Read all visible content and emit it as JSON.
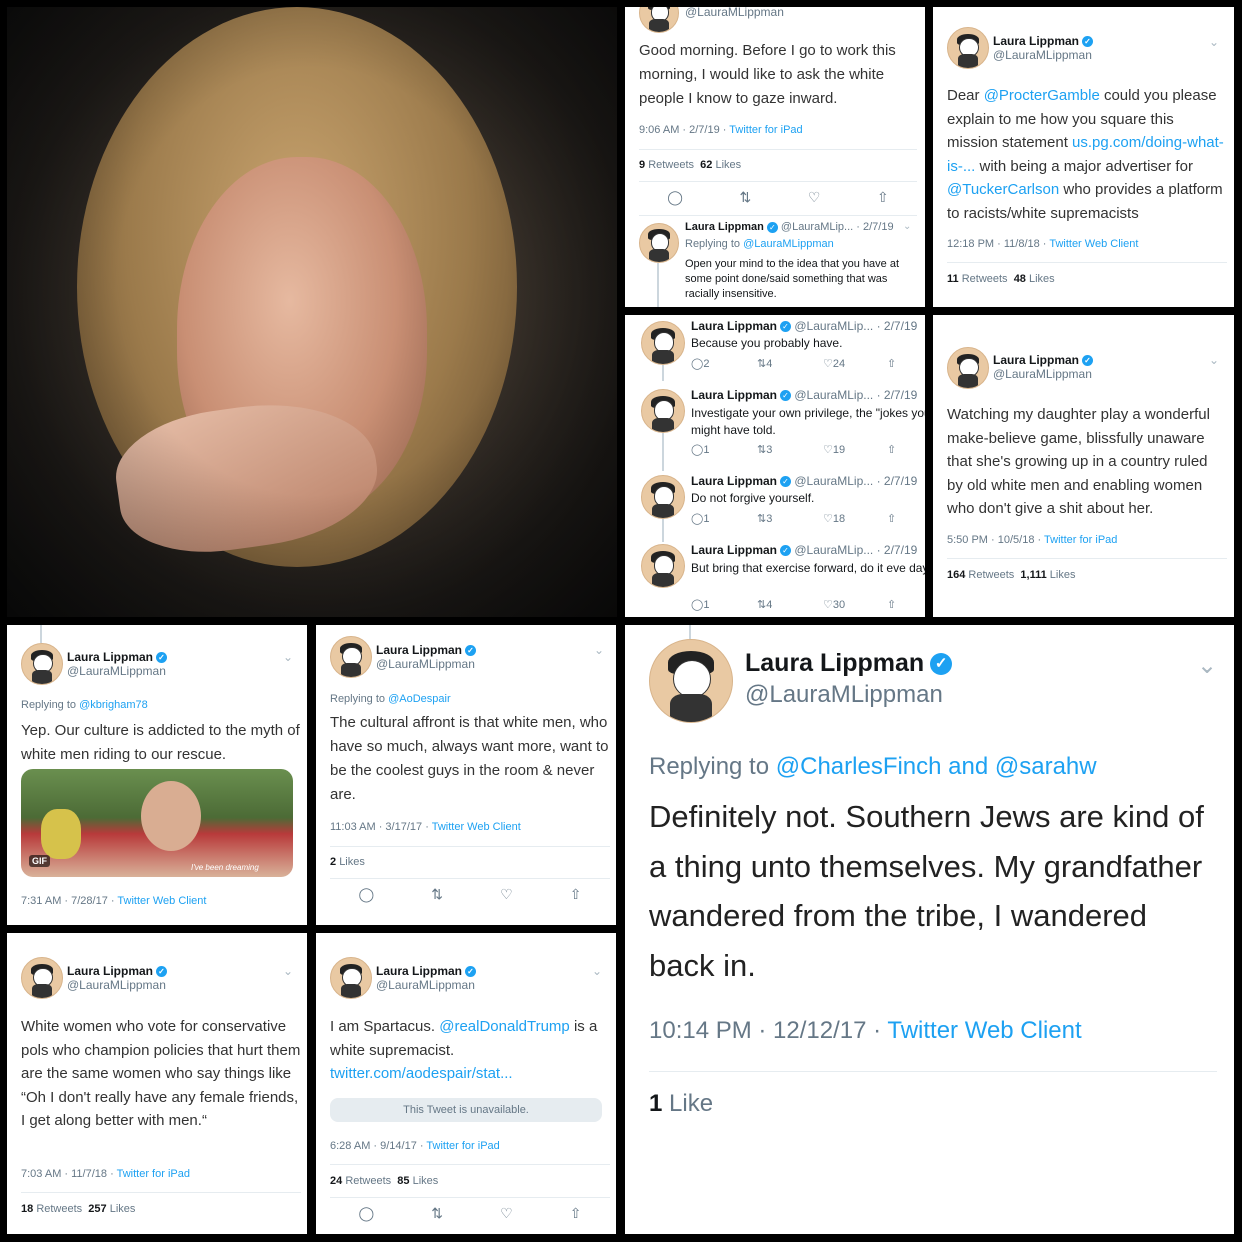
{
  "profile": {
    "name": "Laura Lippman",
    "handle": "@LauraMLippman",
    "handle_short": "@LauraMLip..."
  },
  "icons": {
    "reply": "reply-icon",
    "retweet": "retweet-icon",
    "like": "heart-icon",
    "share": "share-icon",
    "verified": "verified-badge-icon",
    "caret": "chevron-down-icon"
  },
  "colors": {
    "link": "#1da1f2",
    "muted": "#657786"
  },
  "t1": {
    "handle_cut": "@LauraMLippman",
    "text": "Good morning. Before I go to work this morning, I would like to ask the white people I know to gaze inward.",
    "time": "9:06 AM · 2/7/19 · ",
    "client": "Twitter for iPad",
    "retweets": "9",
    "retweets_label": "Retweets",
    "likes": "62",
    "likes_label": "Likes",
    "reply_meta": "· 2/7/19",
    "replying_label": "Replying to ",
    "replying_to": "@LauraMLippman",
    "reply_text": "Open your mind to the idea that you have at some point done/said something that was racially insensitive."
  },
  "t2": {
    "text_1": "Dear ",
    "mention_1": "@ProcterGamble",
    "text_2": " could you please explain to me how you square this mission statement ",
    "link": "us.pg.com/doing-what-is-...",
    "text_3": " with being a major advertiser for ",
    "mention_2": "@TuckerCarlson",
    "text_4": " who provides a platform to racists/white supremacists",
    "time": "12:18 PM · 11/8/18 · ",
    "client": "Twitter Web Client",
    "retweets": "11",
    "retweets_label": "Retweets",
    "likes": "48",
    "likes_label": "Likes"
  },
  "t3": {
    "items": [
      {
        "meta": "· 2/7/19",
        "text": "Because you probably have.",
        "replies": "2",
        "retweets": "4",
        "likes": "24"
      },
      {
        "meta": "· 2/7/19",
        "text": "Investigate your own privilege, the \"jokes you might have told.",
        "replies": "1",
        "retweets": "3",
        "likes": "19"
      },
      {
        "meta": "· 2/7/19",
        "text": "Do not forgive yourself.",
        "replies": "1",
        "retweets": "3",
        "likes": "18"
      },
      {
        "meta": "· 2/7/19",
        "text": "But bring that exercise forward, do it eve day.",
        "replies": "1",
        "retweets": "4",
        "likes": "30"
      }
    ]
  },
  "t4": {
    "text": "Watching my daughter play a wonderful make-believe game, blissfully unaware that she's growing up in a country ruled by old white men and enabling women who don't give a shit about her.",
    "time": "5:50 PM · 10/5/18 · ",
    "client": "Twitter for iPad",
    "retweets": "164",
    "retweets_label": "Retweets",
    "likes": "1,111",
    "likes_label": "Likes"
  },
  "t5": {
    "replying_label": "Replying to ",
    "replying_to": "@kbrigham78",
    "text": "Yep. Our culture is addicted to the myth of white men riding to our rescue.",
    "gif_badge": "GIF",
    "gif_caption": "I've been dreaming",
    "time": "7:31 AM · 7/28/17 · ",
    "client": "Twitter Web Client"
  },
  "t6": {
    "replying_label": "Replying to ",
    "replying_to": "@AoDespair",
    "text": "The cultural affront is that white men, who have so much, always want more, want to be the coolest guys in the room & never are.",
    "time": "11:03 AM · 3/17/17 · ",
    "client": "Twitter Web Client",
    "likes": "2",
    "likes_label": "Likes"
  },
  "t7": {
    "text": "White women who vote for conservative pols who champion policies that hurt them are the same women who say things like “Oh I don't really have any female friends, I get along better with men.“",
    "time": "7:03 AM · 11/7/18 · ",
    "client": "Twitter for iPad",
    "retweets": "18",
    "retweets_label": "Retweets",
    "likes": "257",
    "likes_label": "Likes"
  },
  "t8": {
    "text_1": "I am Spartacus. ",
    "mention": "@realDonaldTrump",
    "text_2": " is a white supremacist. ",
    "link": "twitter.com/aodespair/stat...",
    "unavailable": "This Tweet is unavailable.",
    "time": "6:28 AM · 9/14/17 · ",
    "client": "Twitter for iPad",
    "retweets": "24",
    "retweets_label": "Retweets",
    "likes": "85",
    "likes_label": "Likes"
  },
  "t9": {
    "replying_label": "Replying to ",
    "replying_to": "@CharlesFinch and @sarahw",
    "text": "Definitely not. Southern Jews are kind of a thing unto themselves. My grandfather wandered from the tribe, I wandered back in.",
    "time": "10:14 PM · 12/12/17 · ",
    "client": "Twitter Web Client",
    "likes": "1",
    "likes_label": "Like"
  }
}
